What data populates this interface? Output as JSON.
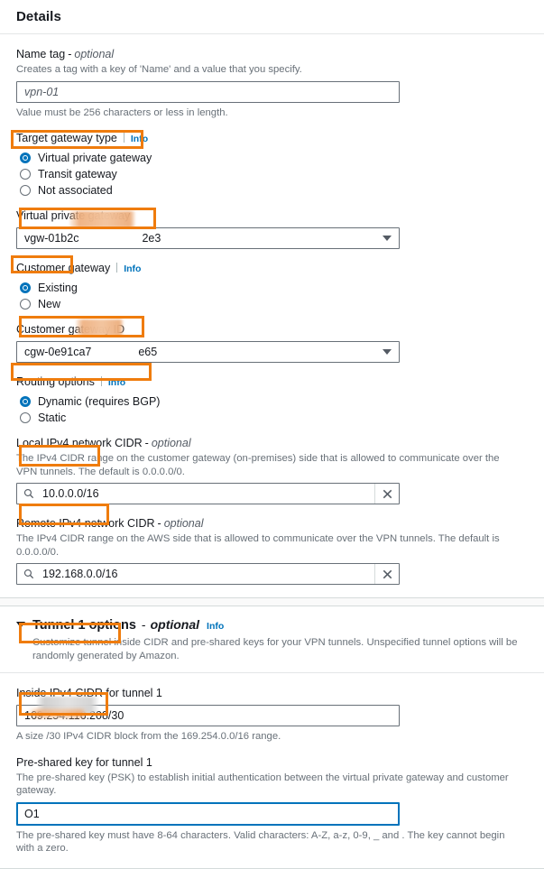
{
  "details_card": {
    "title": "Details",
    "name_tag": {
      "label": "Name tag",
      "optional_suffix": "optional",
      "hint": "Creates a tag with a key of 'Name' and a value that you specify.",
      "value": "vpn-01",
      "footer_hint": "Value must be 256 characters or less in length."
    },
    "target_gateway_type": {
      "label": "Target gateway type",
      "info_label": "Info",
      "options": [
        {
          "label": "Virtual private gateway",
          "selected": true,
          "highlighted": true
        },
        {
          "label": "Transit gateway",
          "selected": false,
          "highlighted": false
        },
        {
          "label": "Not associated",
          "selected": false,
          "highlighted": false
        }
      ]
    },
    "virtual_private_gateway": {
      "label": "Virtual private gateway",
      "value_prefix": "vgw-01b2c",
      "value_suffix": "2e3",
      "redacted": true
    },
    "customer_gateway": {
      "label": "Customer gateway",
      "info_label": "Info",
      "options": [
        {
          "label": "Existing",
          "selected": true,
          "highlighted": true
        },
        {
          "label": "New",
          "selected": false,
          "highlighted": false
        }
      ]
    },
    "customer_gateway_id": {
      "label": "Customer gateway ID",
      "value_prefix": "cgw-0e91ca7",
      "value_suffix": "e65",
      "redacted": true
    },
    "routing_options": {
      "label": "Routing options",
      "info_label": "Info",
      "options": [
        {
          "label": "Dynamic (requires BGP)",
          "selected": true,
          "highlighted": true
        },
        {
          "label": "Static",
          "selected": false,
          "highlighted": false
        }
      ]
    },
    "local_cidr": {
      "label": "Local IPv4 network CIDR",
      "optional_suffix": "optional",
      "hint": "The IPv4 CIDR range on the customer gateway (on-premises) side that is allowed to communicate over the VPN tunnels. The default is 0.0.0.0/0.",
      "value": "10.0.0.0/16",
      "search_icon": "search-icon",
      "clear_icon": "close-icon"
    },
    "remote_cidr": {
      "label": "Remote IPv4 network CIDR",
      "optional_suffix": "optional",
      "hint": "The IPv4 CIDR range on the AWS side that is allowed to communicate over the VPN tunnels. The default is 0.0.0.0/0.",
      "value": "192.168.0.0/16",
      "search_icon": "search-icon",
      "clear_icon": "close-icon"
    }
  },
  "tunnel_card": {
    "header": {
      "title": "Tunnel 1 options",
      "dash": "-",
      "optional_suffix": "optional",
      "info_label": "Info",
      "expanded": true,
      "description": "Customize tunnel inside CIDR and pre-shared keys for your VPN tunnels. Unspecified tunnel options will be randomly generated by Amazon."
    },
    "inside_cidr": {
      "label": "Inside IPv4 CIDR for tunnel 1",
      "value": "169.254.116.208/30",
      "footer_hint": "A size /30 IPv4 CIDR block from the 169.254.0.0/16 range."
    },
    "psk": {
      "label": "Pre-shared key for tunnel 1",
      "hint": "The pre-shared key (PSK) to establish initial authentication between the virtual private gateway and customer gateway.",
      "value_prefix": "O1",
      "redacted": true,
      "focused": true,
      "footer_hint": "The pre-shared key must have 8-64 characters. Valid characters: A-Z, a-z, 0-9, _ and . The key cannot begin with a zero."
    }
  },
  "colors": {
    "annotation": "#ef7c0d",
    "accent": "#0073bb",
    "label": "#16191f",
    "hint": "#687078",
    "border": "#687078",
    "card_border": "#d5dbdb"
  }
}
